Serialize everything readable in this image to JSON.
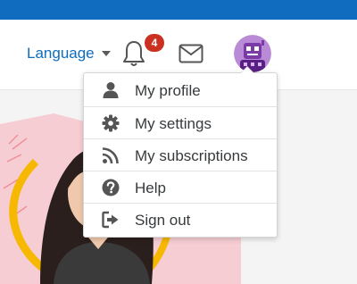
{
  "colors": {
    "brand": "#0f6cbf",
    "badge": "#ca3120",
    "avatar": "#8a3fb5"
  },
  "navbar": {
    "language_label": "Language",
    "notifications_count": "4"
  },
  "user_menu": {
    "items": [
      {
        "label": "My profile",
        "icon": "user-icon"
      },
      {
        "label": "My settings",
        "icon": "gear-icon"
      },
      {
        "label": "My subscriptions",
        "icon": "rss-icon"
      },
      {
        "label": "Help",
        "icon": "question-circle-icon"
      },
      {
        "label": "Sign out",
        "icon": "sign-out-icon"
      }
    ]
  }
}
